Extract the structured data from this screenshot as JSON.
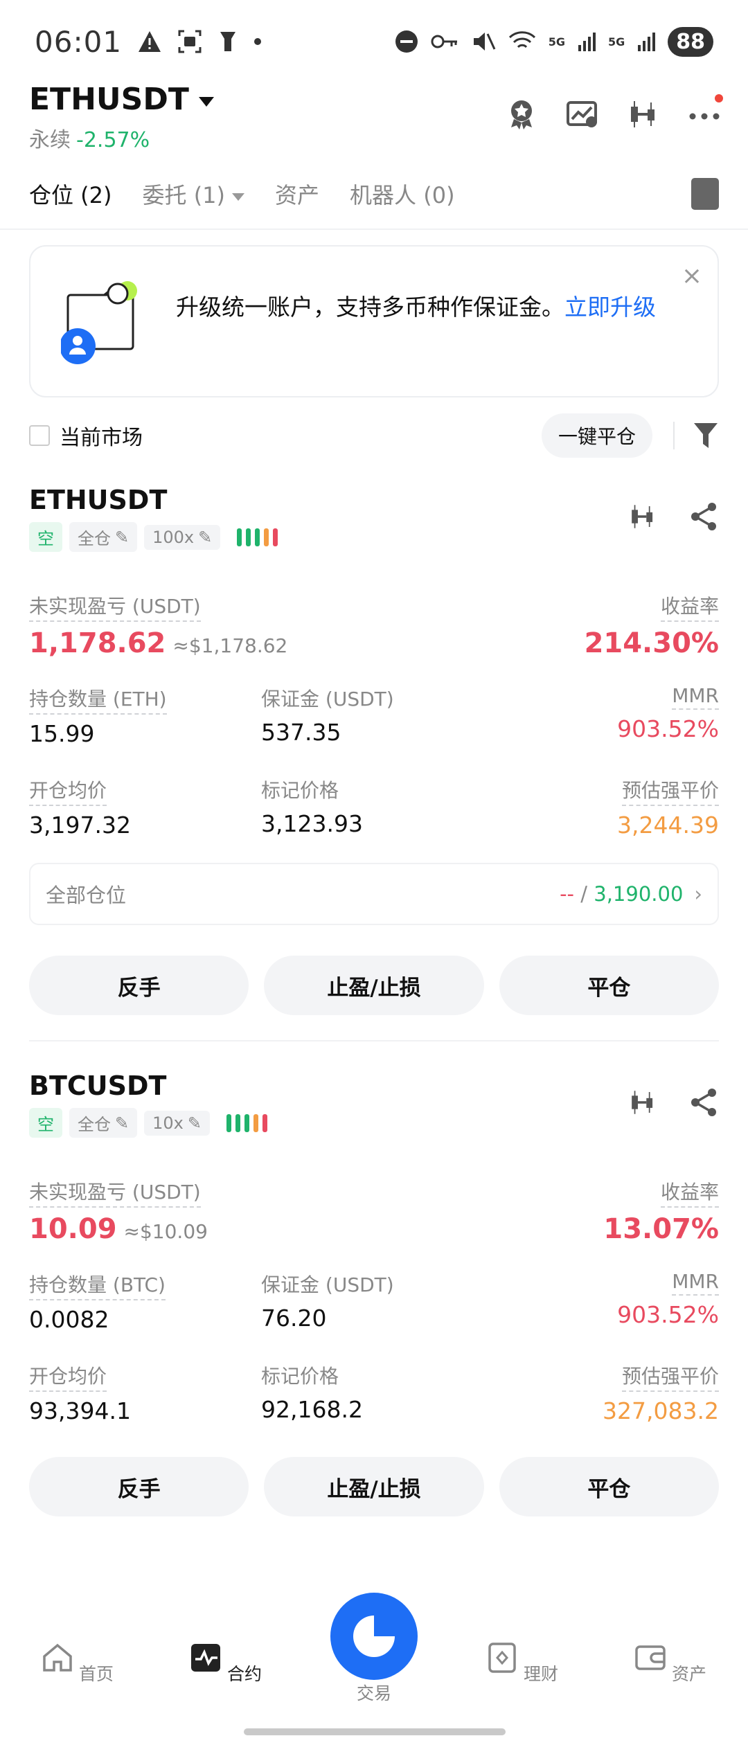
{
  "status_bar": {
    "time": "06:01",
    "battery": "88",
    "net1": "5G",
    "net2": "5G"
  },
  "header": {
    "pair": "ETHUSDT",
    "type": "永续",
    "change": "-2.57%"
  },
  "tabs": [
    {
      "label": "仓位 (2)"
    },
    {
      "label": "委托 (1)"
    },
    {
      "label": "资产"
    },
    {
      "label": "机器人 (0)"
    }
  ],
  "promo": {
    "text": "升级统一账户，支持多币种作保证金。",
    "link": "立即升级",
    "close": "×"
  },
  "filter": {
    "current_market": "当前市场",
    "one_click_close": "一键平仓"
  },
  "labels": {
    "unrealized": "未实现盈亏 (USDT)",
    "roe": "收益率",
    "margin": "保证金 (USDT)",
    "mmr": "MMR",
    "entry": "开仓均价",
    "mark": "标记价格",
    "liq": "预估强平价",
    "all_positions": "全部仓位",
    "reverse": "反手",
    "tpsl": "止盈/止损",
    "close": "平仓"
  },
  "positions": [
    {
      "symbol": "ETHUSDT",
      "side": "空",
      "mode": "全仓",
      "leverage": "100x",
      "pnl": "1,178.62",
      "pnl_usd": "≈$1,178.62",
      "roe": "214.30%",
      "qty_label": "持仓数量 (ETH)",
      "qty": "15.99",
      "margin": "537.35",
      "mmr": "903.52%",
      "entry": "3,197.32",
      "mark": "3,123.93",
      "liq": "3,244.39",
      "all_left": "--",
      "all_slash": "/",
      "all_right": "3,190.00"
    },
    {
      "symbol": "BTCUSDT",
      "side": "空",
      "mode": "全仓",
      "leverage": "10x",
      "pnl": "10.09",
      "pnl_usd": "≈$10.09",
      "roe": "13.07%",
      "qty_label": "持仓数量 (BTC)",
      "qty": "0.0082",
      "margin": "76.20",
      "mmr": "903.52%",
      "entry": "93,394.1",
      "mark": "92,168.2",
      "liq": "327,083.2"
    }
  ],
  "bottom_nav": [
    "首页",
    "合约",
    "交易",
    "理财",
    "资产"
  ],
  "colors": {
    "accent": "#1e6ef5",
    "loss": "#e84a5f",
    "gain": "#1fb36b",
    "warn": "#f39c42"
  }
}
